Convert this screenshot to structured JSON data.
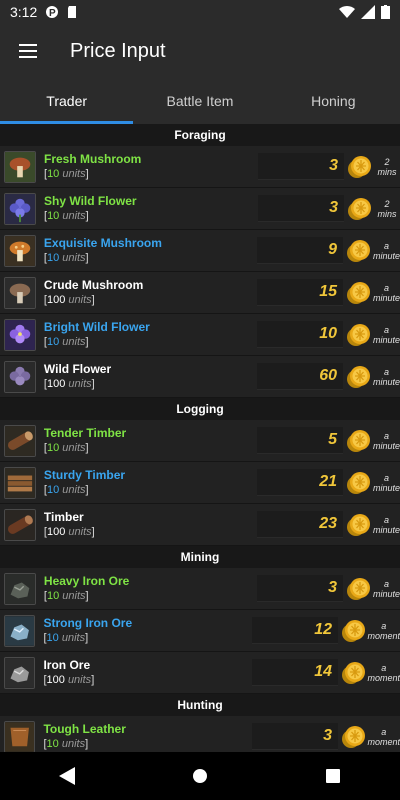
{
  "status": {
    "time": "3:12"
  },
  "appbar": {
    "title": "Price Input"
  },
  "tabs": [
    {
      "label": "Trader"
    },
    {
      "label": "Battle Item"
    },
    {
      "label": "Honing"
    }
  ],
  "colors": {
    "green": "#7fe345",
    "blue": "#3aa5ef",
    "white": "#ffffff",
    "gold": "#f0c63a",
    "accent": "#2f8de4"
  },
  "sections": [
    {
      "title": "Foraging"
    },
    {
      "title": "Logging"
    },
    {
      "title": "Mining"
    },
    {
      "title": "Hunting"
    }
  ],
  "items": [
    {
      "name": "Fresh Mushroom",
      "units": "10",
      "price": "3",
      "time": "2 mins",
      "color": "#7fe345",
      "icon": "fresh-mushroom-icon"
    },
    {
      "name": "Shy Wild Flower",
      "units": "10",
      "price": "3",
      "time": "2 mins",
      "color": "#7fe345",
      "icon": "shy-wild-flower-icon"
    },
    {
      "name": "Exquisite Mushroom",
      "units": "10",
      "price": "9",
      "time": "a minute",
      "color": "#3aa5ef",
      "icon": "exquisite-mushroom-icon"
    },
    {
      "name": "Crude Mushroom",
      "units": "100",
      "price": "15",
      "time": "a minute",
      "color": "#ffffff",
      "icon": "crude-mushroom-icon"
    },
    {
      "name": "Bright Wild Flower",
      "units": "10",
      "price": "10",
      "time": "a minute",
      "color": "#3aa5ef",
      "icon": "bright-wild-flower-icon"
    },
    {
      "name": "Wild Flower",
      "units": "100",
      "price": "60",
      "time": "a minute",
      "color": "#ffffff",
      "icon": "wild-flower-icon"
    },
    {
      "name": "Tender Timber",
      "units": "10",
      "price": "5",
      "time": "a minute",
      "color": "#7fe345",
      "icon": "tender-timber-icon"
    },
    {
      "name": "Sturdy Timber",
      "units": "10",
      "price": "21",
      "time": "a minute",
      "color": "#3aa5ef",
      "icon": "sturdy-timber-icon"
    },
    {
      "name": "Timber",
      "units": "100",
      "price": "23",
      "time": "a minute",
      "color": "#ffffff",
      "icon": "timber-icon"
    },
    {
      "name": "Heavy Iron Ore",
      "units": "10",
      "price": "3",
      "time": "a minute",
      "color": "#7fe345",
      "icon": "heavy-iron-ore-icon"
    },
    {
      "name": "Strong Iron Ore",
      "units": "10",
      "price": "12",
      "time": "a moment",
      "color": "#3aa5ef",
      "icon": "strong-iron-ore-icon"
    },
    {
      "name": "Iron Ore",
      "units": "100",
      "price": "14",
      "time": "a moment",
      "color": "#ffffff",
      "icon": "iron-ore-icon"
    },
    {
      "name": "Tough Leather",
      "units": "10",
      "price": "3",
      "time": "a moment",
      "color": "#7fe345",
      "icon": "tough-leather-icon"
    }
  ],
  "units_word": "units",
  "navbar": {
    "back": "back-icon",
    "home": "home-icon",
    "recents": "recents-icon"
  }
}
